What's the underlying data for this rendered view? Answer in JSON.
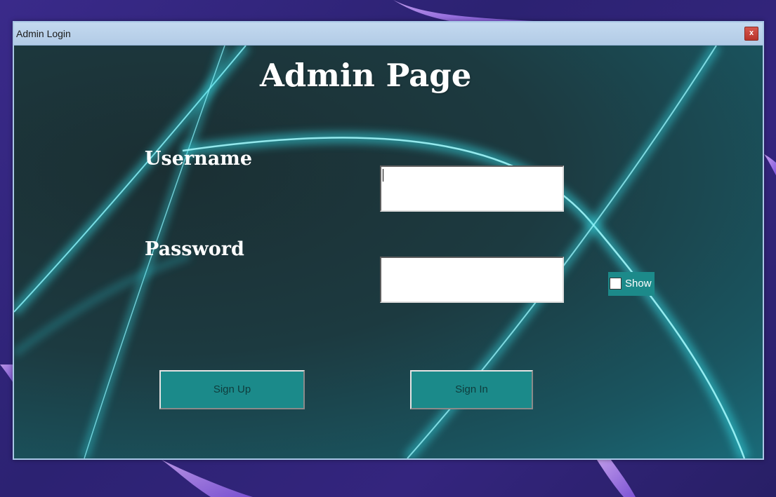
{
  "window": {
    "title": "Admin Login",
    "close_label": "x"
  },
  "form": {
    "heading": "Admin Page",
    "username_label": "Username",
    "username_value": "",
    "password_label": "Password",
    "password_value": "",
    "show_label": "Show",
    "show_checked": false,
    "signup_label": "Sign Up",
    "signin_label": "Sign In"
  },
  "colors": {
    "desktop_bg": "#2c2272",
    "client_bg": "#1c3a40",
    "glow": "#3ae6f0",
    "button_bg": "#1b8a8a",
    "titlebar": "#b2cbe6",
    "close_button": "#c8443a"
  },
  "icons": {
    "close": "close-icon",
    "checkbox": "checkbox-icon"
  }
}
